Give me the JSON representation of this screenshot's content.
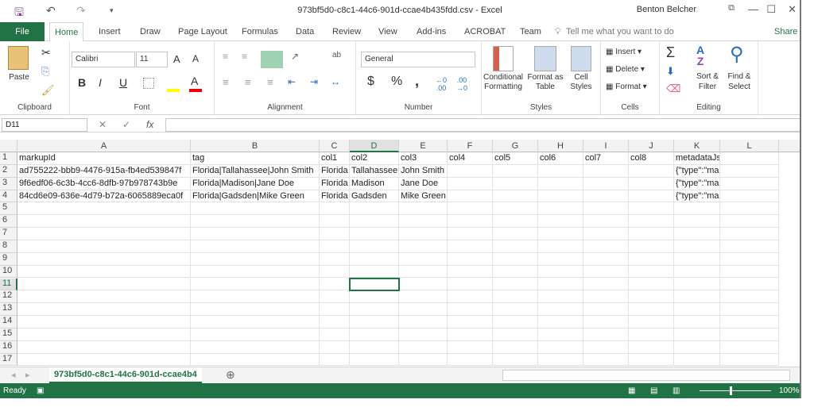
{
  "window": {
    "title": "973bf5d0-c8c1-44c6-901d-ccae4b435fdd.csv  -  Excel",
    "user": "Benton Belcher"
  },
  "ribbon_tabs": [
    "File",
    "Home",
    "Insert",
    "Draw",
    "Page Layout",
    "Formulas",
    "Data",
    "Review",
    "View",
    "Add-ins",
    "ACROBAT",
    "Team"
  ],
  "tell_me": "Tell me what you want to do",
  "share": "Share",
  "ribbon": {
    "clipboard": {
      "label": "Clipboard",
      "paste": "Paste"
    },
    "font": {
      "label": "Font",
      "name": "Calibri",
      "size": "11",
      "bold": "B",
      "italic": "I",
      "underline": "U"
    },
    "alignment": {
      "label": "Alignment"
    },
    "number": {
      "label": "Number",
      "format": "General",
      "currency": "$",
      "percent": "%",
      "comma": ","
    },
    "styles": {
      "label": "Styles",
      "conditional": "Conditional Formatting",
      "format_table": "Format as Table",
      "cell_styles": "Cell Styles"
    },
    "cells": {
      "label": "Cells",
      "insert": "Insert",
      "delete": "Delete",
      "format": "Format"
    },
    "editing": {
      "label": "Editing",
      "sort": "Sort & Filter",
      "find": "Find & Select",
      "sum": "Σ"
    }
  },
  "formula_bar": {
    "name_box": "D11",
    "fx": "fx",
    "value": ""
  },
  "columns": [
    "A",
    "B",
    "C",
    "D",
    "E",
    "F",
    "G",
    "H",
    "I",
    "J",
    "K",
    "L"
  ],
  "selected_cell": {
    "col": "D",
    "row": 11
  },
  "rows": [
    [
      "markupId",
      "tag",
      "col1",
      "col2",
      "col3",
      "col4",
      "col5",
      "col6",
      "col7",
      "col8",
      "metadataJson",
      ""
    ],
    [
      "ad755222-bbb9-4476-915a-fb4ed539847f",
      "Florida|Tallahassee|John Smith",
      "Florida",
      "Tallahassee",
      "John Smith",
      "",
      "",
      "",
      "",
      "",
      "{\"type\":\"markup-builder\",\"sub",
      ""
    ],
    [
      "9f6edf06-6c3b-4cc6-8dfb-97b978743b9e",
      "Florida|Madison|Jane Doe",
      "Florida",
      "Madison",
      "Jane Doe",
      "",
      "",
      "",
      "",
      "",
      "{\"type\":\"markup-builder\",\"sub",
      ""
    ],
    [
      "84cd6e09-636e-4d79-b72a-6065889eca0f",
      "Florida|Gadsden|Mike Green",
      "Florida",
      "Gadsden",
      "Mike Green",
      "",
      "",
      "",
      "",
      "",
      "{\"type\":\"markup-builder\",\"sub",
      ""
    ]
  ],
  "row_count": 17,
  "sheet_tab": "973bf5d0-c8c1-44c6-901d-ccae4b4",
  "status": {
    "text": "Ready",
    "zoom": "100%"
  },
  "colors": {
    "accent": "#217346"
  }
}
